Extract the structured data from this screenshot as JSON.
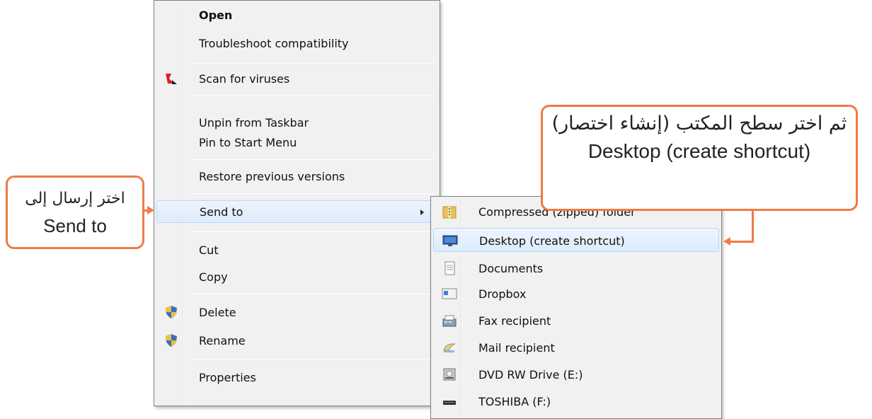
{
  "context_menu": {
    "items": [
      {
        "label": "Open"
      },
      {
        "label": "Troubleshoot compatibility"
      },
      {
        "label": "Scan for viruses"
      },
      {
        "label": "Unpin from Taskbar"
      },
      {
        "label": "Pin to Start Menu"
      },
      {
        "label": "Restore previous versions"
      },
      {
        "label": "Send to"
      },
      {
        "label": "Cut"
      },
      {
        "label": "Copy"
      },
      {
        "label": "Delete"
      },
      {
        "label": "Rename"
      },
      {
        "label": "Properties"
      }
    ]
  },
  "send_to_menu": {
    "items": [
      {
        "label": "Compressed (zipped) folder"
      },
      {
        "label": "Desktop (create shortcut)"
      },
      {
        "label": "Documents"
      },
      {
        "label": "Dropbox"
      },
      {
        "label": "Fax recipient"
      },
      {
        "label": "Mail recipient"
      },
      {
        "label": "DVD RW Drive (E:)"
      },
      {
        "label": "TOSHIBA (F:)"
      }
    ]
  },
  "callouts": {
    "left": {
      "arabic": "اختر إرسال إلى",
      "english": "Send to"
    },
    "right": {
      "arabic": "ثم اختر سطح المكتب (إنشاء اختصار)",
      "english": "Desktop (create shortcut)"
    }
  },
  "colors": {
    "callout_border": "#ef7b45",
    "menu_background": "#f1f1f1",
    "hover_background": "#dcebfc"
  }
}
